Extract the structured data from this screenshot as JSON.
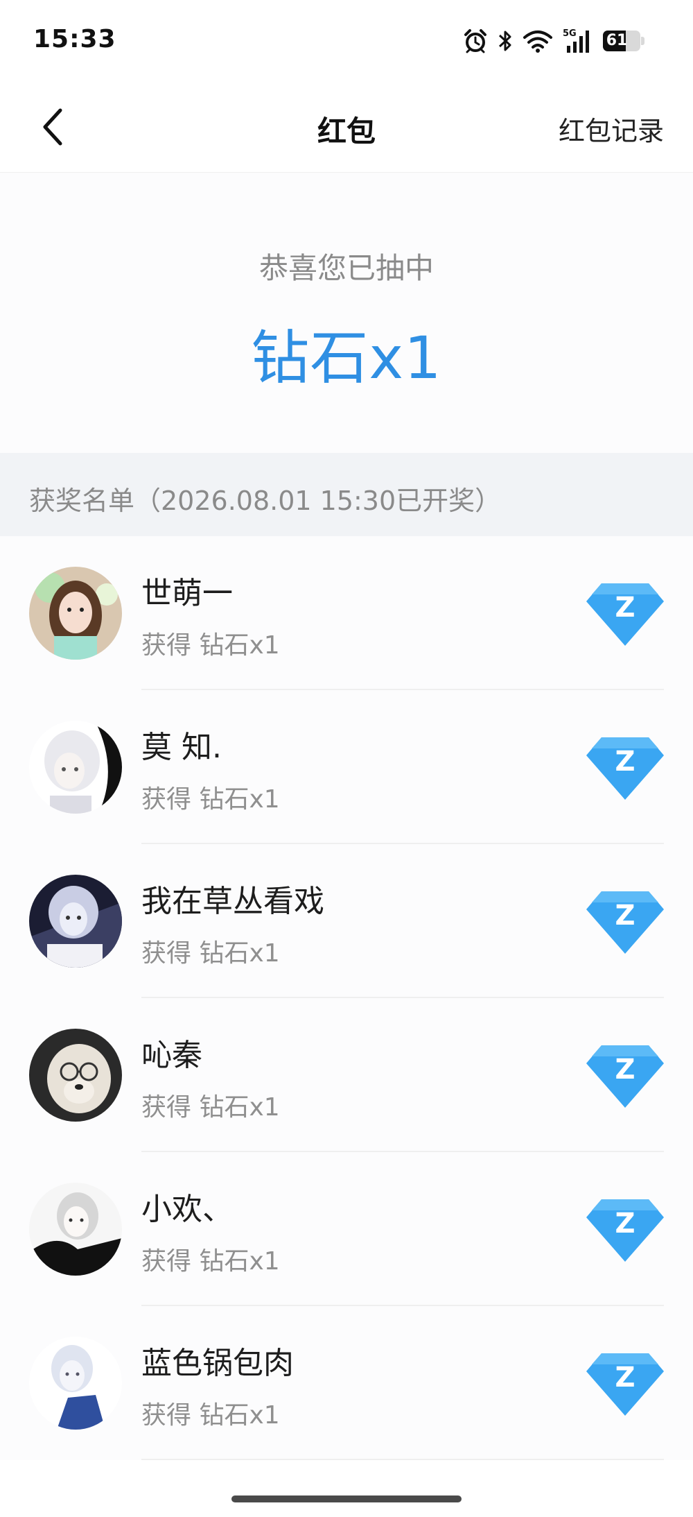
{
  "status_bar": {
    "time": "15:33",
    "network": "5G",
    "battery": "61",
    "battery_level": 0.61
  },
  "nav": {
    "title": "红包",
    "right_link": "红包记录",
    "back_icon": "chevron-left-icon"
  },
  "prize": {
    "caption": "恭喜您已抽中",
    "value": "钻石x1",
    "accent_color": "#2f8fe3"
  },
  "winners_header": "获奖名单（2026.08.01 15:30已开奖）",
  "winners": [
    {
      "name": "世萌一",
      "prize": "获得 钻石x1"
    },
    {
      "name": "莫 知.",
      "prize": "获得 钻石x1"
    },
    {
      "name": "我在草丛看戏",
      "prize": "获得 钻石x1"
    },
    {
      "name": "吣秦",
      "prize": "获得 钻石x1"
    },
    {
      "name": "小欢、",
      "prize": "获得 钻石x1"
    },
    {
      "name": "蓝色锅包肉",
      "prize": "获得 钻石x1"
    }
  ],
  "diamond_icon": {
    "icon": "diamond-icon",
    "letter": "Z",
    "color": "#3aa6f2"
  }
}
